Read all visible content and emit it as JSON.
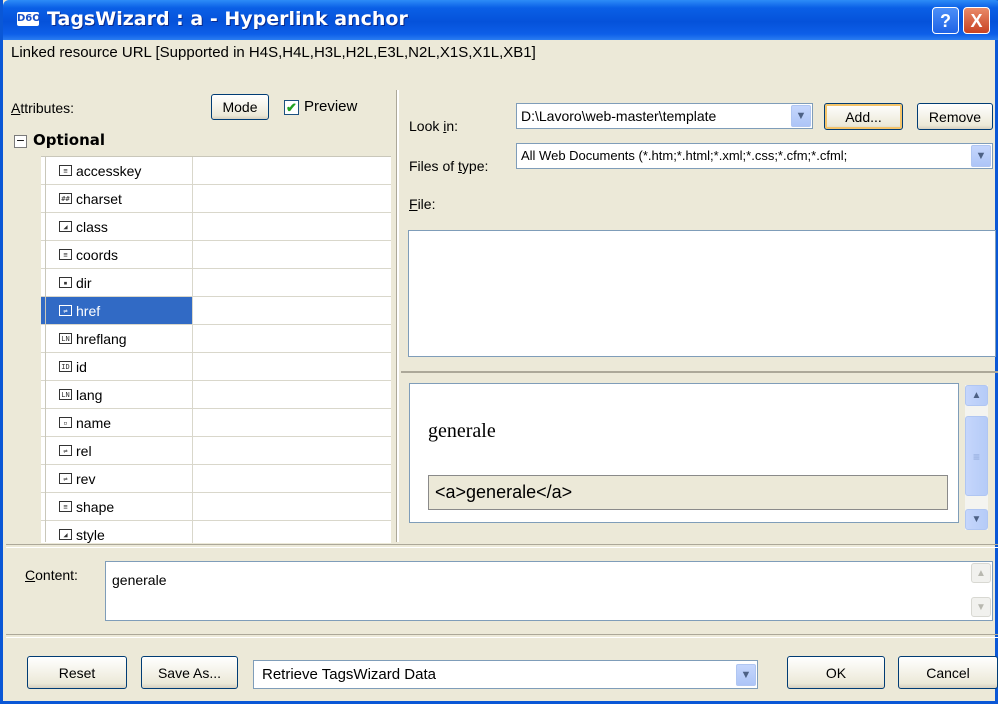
{
  "window": {
    "logo_text": "D6O",
    "title": "TagsWizard : a - Hyperlink anchor",
    "help_label": "?",
    "close_label": "X",
    "subtitle": "Linked resource URL  [Supported in H4S,H4L,H3L,H2L,E3L,N2L,X1S,X1L,XB1]"
  },
  "attributes": {
    "label_first": "A",
    "label_rest": "ttributes:",
    "mode_label": "Mode",
    "preview_label": "Preview",
    "preview_checked": true,
    "optional_header": "Optional",
    "collapse_glyph": "−",
    "items": [
      {
        "name": "accesskey",
        "icon": "text-field-icon",
        "glyph": "≡"
      },
      {
        "name": "charset",
        "icon": "charset-icon",
        "glyph": "##"
      },
      {
        "name": "class",
        "icon": "class-icon",
        "glyph": "◢"
      },
      {
        "name": "coords",
        "icon": "text-field-icon",
        "glyph": "≡"
      },
      {
        "name": "dir",
        "icon": "dir-icon",
        "glyph": "▪"
      },
      {
        "name": "href",
        "icon": "url-icon",
        "glyph": "⇌"
      },
      {
        "name": "hreflang",
        "icon": "lang-icon",
        "glyph": "LN"
      },
      {
        "name": "id",
        "icon": "id-icon",
        "glyph": "ID"
      },
      {
        "name": "lang",
        "icon": "lang-icon",
        "glyph": "LN"
      },
      {
        "name": "name",
        "icon": "name-icon",
        "glyph": "▫"
      },
      {
        "name": "rel",
        "icon": "url-icon",
        "glyph": "⇌"
      },
      {
        "name": "rev",
        "icon": "url-icon",
        "glyph": "⇌"
      },
      {
        "name": "shape",
        "icon": "text-field-icon",
        "glyph": "≡"
      },
      {
        "name": "style",
        "icon": "style-icon",
        "glyph": "◢"
      }
    ],
    "selected": "href"
  },
  "file_browser": {
    "look_in_pre": "Look ",
    "look_in_key": "i",
    "look_in_post": "n:",
    "look_in_value": "D:\\Lavoro\\web-master\\template",
    "add_label": "Add...",
    "remove_label": "Remove",
    "files_type_pre": "Files of ",
    "files_type_key": "t",
    "files_type_post": "ype:",
    "files_type_value": "All Web Documents (*.htm;*.html;*.xml;*.css;*.cfm;*.cfml;",
    "file_key": "F",
    "file_rest": "ile:",
    "dropdown_glyph": "▼"
  },
  "preview": {
    "rendered_text": "generale",
    "code_text": "<a>generale</a>",
    "scroll_up": "▲",
    "scroll_down": "▼",
    "thumb_grip": "≡"
  },
  "content": {
    "label_key": "C",
    "label_rest": "ontent:",
    "value": "generale"
  },
  "footer": {
    "reset_label": "Reset",
    "save_as_label": "Save As...",
    "action_select_value": "Retrieve TagsWizard Data",
    "ok_label": "OK",
    "cancel_label": "Cancel"
  }
}
